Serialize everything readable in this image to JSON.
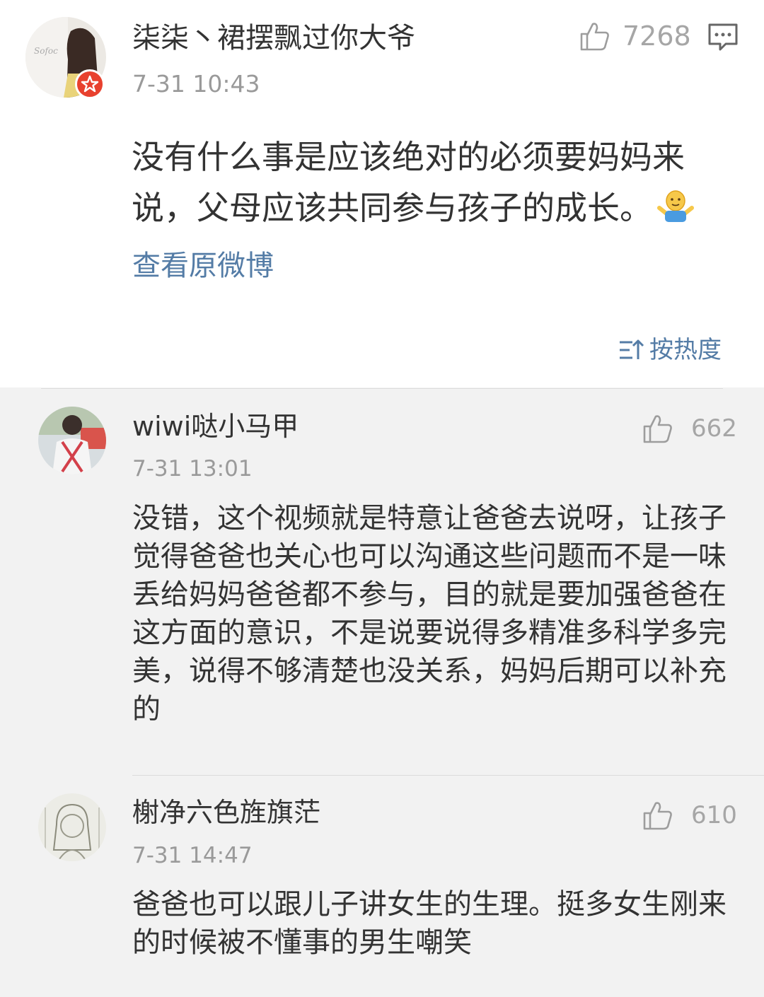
{
  "main_post": {
    "username": "柒柒丶裙摆飘过你大爷",
    "timestamp": "7-31 10:43",
    "likes": "7268",
    "text": "没有什么事是应该绝对的必须要妈妈来说，父母应该共同参与孩子的成长。",
    "emoji": "shrug-emoji",
    "view_original": "查看原微博",
    "sort_label": "按热度",
    "accent_color": "#547ca6",
    "badge_color": "#e8412e"
  },
  "comments": [
    {
      "username": "wiwi哒小马甲",
      "timestamp": "7-31 13:01",
      "likes": "662",
      "text": "没错，这个视频就是特意让爸爸去说呀，让孩子觉得爸爸也关心也可以沟通这些问题而不是一味丢给妈妈爸爸都不参与，目的就是要加强爸爸在这方面的意识，不是说要说得多精准多科学多完美，说得不够清楚也没关系，妈妈后期可以补充的"
    },
    {
      "username": "榭净六色旌旗茫",
      "timestamp": "7-31 14:47",
      "likes": "610",
      "text": "爸爸也可以跟儿子讲女生的生理。挺多女生刚来的时候被不懂事的男生嘲笑"
    }
  ],
  "icons": [
    "thumbs-up-icon",
    "comment-icon",
    "sort-icon",
    "verified-badge-icon",
    "shrug-emoji"
  ]
}
